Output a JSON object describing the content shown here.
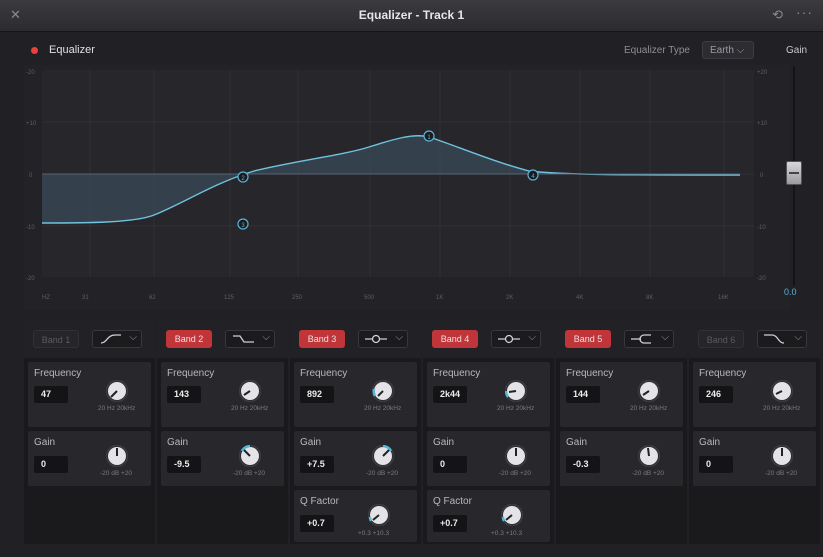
{
  "window": {
    "title": "Equalizer - Track 1",
    "close_icon": "close-icon",
    "reset_icon": "reset-icon",
    "more_icon": "more-icon"
  },
  "header": {
    "enable_label": "Equalizer",
    "type_label": "Equalizer Type",
    "type_value": "Earth ⌵",
    "gain_label": "Gain"
  },
  "graph": {
    "y_ticks_left": [
      "-20",
      "+10",
      "0",
      "-10",
      "-20"
    ],
    "y_ticks_right": [
      "+20",
      "+10",
      "0",
      "-10",
      "-20"
    ],
    "x_ticks": [
      "HZ",
      "31",
      "62",
      "125",
      "250",
      "500",
      "1K",
      "2K",
      "4K",
      "8K",
      "16K"
    ],
    "curve_color": "#4fb9d9",
    "nodes": [
      "1",
      "2",
      "3",
      "4"
    ]
  },
  "fader": {
    "value": "0.0"
  },
  "bands": [
    {
      "name": "Band 1",
      "active": false,
      "frequency_label": "Frequency",
      "frequency": "47",
      "freq_scale": "20  Hz  20kHz",
      "gain_label": "Gain",
      "gain": "0",
      "gain_scale": "-20  dB  +20"
    },
    {
      "name": "Band 2",
      "active": true,
      "frequency_label": "Frequency",
      "frequency": "143",
      "freq_scale": "20  Hz  20kHz",
      "gain_label": "Gain",
      "gain": "-9.5",
      "gain_scale": "-20  dB  +20"
    },
    {
      "name": "Band 3",
      "active": true,
      "frequency_label": "Frequency",
      "frequency": "892",
      "freq_scale": "20  Hz  20kHz",
      "gain_label": "Gain",
      "gain": "+7.5",
      "gain_scale": "-20  dB  +20",
      "q_label": "Q Factor",
      "q": "+0.7",
      "q_scale": "+0.3    +10.3"
    },
    {
      "name": "Band 4",
      "active": true,
      "frequency_label": "Frequency",
      "frequency": "2k44",
      "freq_scale": "20  Hz  20kHz",
      "gain_label": "Gain",
      "gain": "0",
      "gain_scale": "-20  dB  +20",
      "q_label": "Q Factor",
      "q": "+0.7",
      "q_scale": "+0.3    +10.3"
    },
    {
      "name": "Band 5",
      "active": true,
      "frequency_label": "Frequency",
      "frequency": "144",
      "freq_scale": "20  Hz  20kHz",
      "gain_label": "Gain",
      "gain": "-0.3",
      "gain_scale": "-20  dB  +20"
    },
    {
      "name": "Band 6",
      "active": false,
      "frequency_label": "Frequency",
      "frequency": "246",
      "freq_scale": "20  Hz  20kHz",
      "gain_label": "Gain",
      "gain": "0",
      "gain_scale": "-20  dB  +20"
    }
  ]
}
